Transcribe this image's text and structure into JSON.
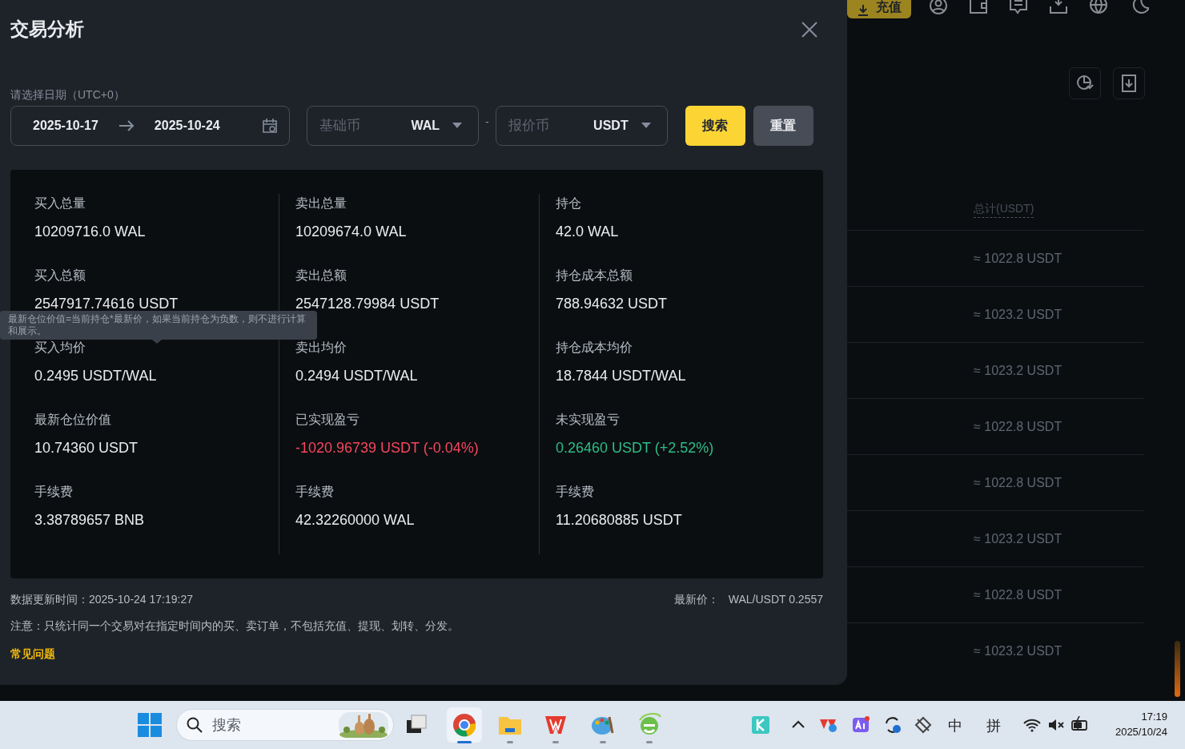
{
  "background": {
    "deposit_button": "充值",
    "table_header": "总计(USDT)",
    "rows": [
      "≈ 1022.8 USDT",
      "≈ 1023.2 USDT",
      "≈ 1023.2 USDT",
      "≈ 1022.8 USDT",
      "≈ 1022.8 USDT",
      "≈ 1023.2 USDT",
      "≈ 1022.8 USDT",
      "≈ 1023.2 USDT"
    ]
  },
  "dialog": {
    "title": "交易分析",
    "date_label": "请选择日期（UTC+0）",
    "date_from": "2025-10-17",
    "date_to": "2025-10-24",
    "base": {
      "label": "基础币",
      "value": "WAL"
    },
    "separator": "-",
    "quote": {
      "label": "报价币",
      "value": "USDT"
    },
    "buttons": [
      {
        "label": "搜索",
        "kind": "primary"
      },
      {
        "label": "重置",
        "kind": "secondary"
      }
    ],
    "stats": [
      {
        "label": "买入总量",
        "value": "10209716.0 WAL"
      },
      {
        "label": "卖出总量",
        "value": "10209674.0 WAL"
      },
      {
        "label": "持仓",
        "value": "42.0 WAL"
      },
      {
        "label": "买入总额",
        "value": "2547917.74616 USDT"
      },
      {
        "label": "卖出总额",
        "value": "2547128.79984 USDT"
      },
      {
        "label": "持仓成本总额",
        "value": "788.94632 USDT"
      },
      {
        "label": "买入均价",
        "value": "0.2495 USDT/WAL"
      },
      {
        "label": "卖出均价",
        "value": "0.2494 USDT/WAL"
      },
      {
        "label": "持仓成本均价",
        "value": "18.7844 USDT/WAL"
      },
      {
        "label": "最新仓位价值",
        "value": "10.74360 USDT"
      },
      {
        "label": "已实现盈亏",
        "value": "-1020.96739 USDT (-0.04%)",
        "color": "#f6465d"
      },
      {
        "label": "未实现盈亏",
        "value": "0.26460 USDT (+2.52%)",
        "color": "#2ebd85"
      },
      {
        "label": "手续费",
        "value": "3.38789657 BNB"
      },
      {
        "label": "手续费",
        "value": "42.32260000 WAL"
      },
      {
        "label": "手续费",
        "value": "11.20680885 USDT"
      }
    ],
    "tooltip": "最新仓位价值=当前持仓*最新价，如果当前持仓为负数，则不进行计算和展示。",
    "update_time": "数据更新时间：2025-10-24 17:19:27",
    "price_label": "最新价：",
    "price": "WAL/USDT 0.2557",
    "note": "注意：只统计同一个交易对在指定时间内的买、卖订单，不包括充值、提现、划转、分发。",
    "faq_link": "常见问题"
  },
  "taskbar": {
    "search_placeholder": "搜索",
    "apps": [
      {
        "kind": "taskview",
        "active": false
      },
      {
        "kind": "chrome",
        "active": true
      },
      {
        "kind": "folder",
        "active": false
      },
      {
        "kind": "wps",
        "active": false
      },
      {
        "kind": "paint",
        "active": false
      },
      {
        "kind": "ie",
        "active": false
      }
    ],
    "ime_mode": "中",
    "ime_name": "拼",
    "time": "17:19",
    "date": "2025/10/24"
  }
}
